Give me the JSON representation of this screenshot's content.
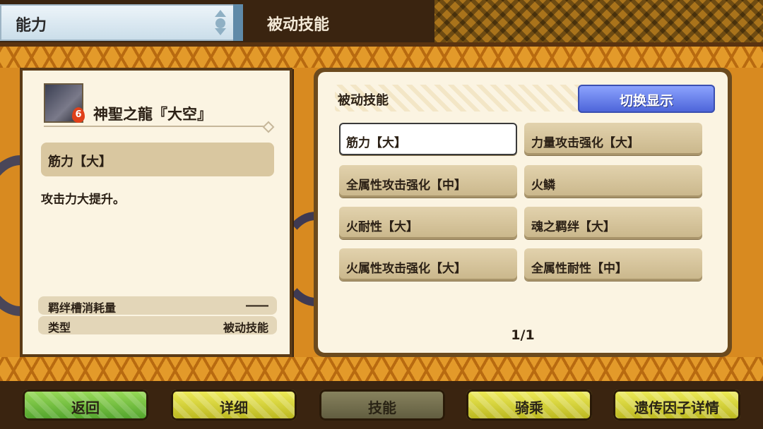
{
  "header": {
    "category": "能力",
    "title": "被动技能"
  },
  "monster": {
    "name": "神聖之龍『大空』",
    "badge": "6"
  },
  "detail": {
    "skill_name": "筋力【大】",
    "description": "攻击力大提升。",
    "rows": [
      {
        "key": "羁绊槽消耗量",
        "value": "――"
      },
      {
        "key": "类型",
        "value": "被动技能"
      }
    ]
  },
  "panel": {
    "title": "被动技能",
    "toggle_label": "切换显示",
    "skills": [
      "筋力【大】",
      "力量攻击强化【大】",
      "全属性攻击强化【中】",
      "火鳞",
      "火耐性【大】",
      "魂之羁绊【大】",
      "火属性攻击强化【大】",
      "全属性耐性【中】"
    ],
    "page": "1/1"
  },
  "bottom_buttons": {
    "back": "返回",
    "detail": "详细",
    "skill": "技能",
    "ride": "骑乘",
    "gene": "遗传因子详情"
  }
}
